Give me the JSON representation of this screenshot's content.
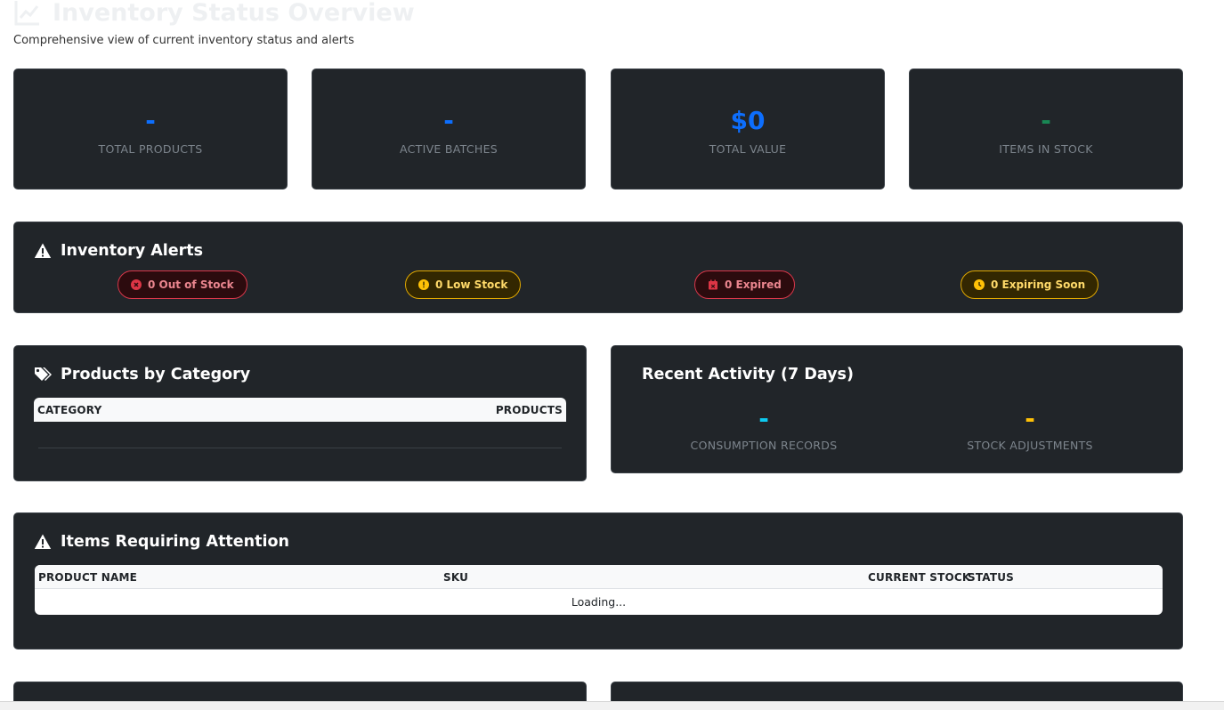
{
  "header": {
    "title": "Inventory Status Overview",
    "title_icon": "chart-line-icon",
    "subtitle": "Comprehensive view of current inventory status and alerts"
  },
  "stats": [
    {
      "value": "-",
      "label": "TOTAL PRODUCTS",
      "color": "#0d6efd"
    },
    {
      "value": "-",
      "label": "ACTIVE BATCHES",
      "color": "#0d6efd"
    },
    {
      "value": "$0",
      "label": "TOTAL VALUE",
      "color": "#0d6efd"
    },
    {
      "value": "-",
      "label": "ITEMS IN STOCK",
      "color": "#198754"
    }
  ],
  "alerts": {
    "title": "Inventory Alerts",
    "icon": "warning-triangle-icon",
    "badges": [
      {
        "label": "0 Out of Stock",
        "icon": "x-circle-icon",
        "color": "#dc3545"
      },
      {
        "label": "0 Low Stock",
        "icon": "exclamation-circle-icon",
        "color": "#ffc107"
      },
      {
        "label": "0 Expired",
        "icon": "calendar-x-icon",
        "color": "#dc3545"
      },
      {
        "label": "0 Expiring Soon",
        "icon": "clock-icon",
        "color": "#ffc107"
      }
    ]
  },
  "category": {
    "title": "Products by Category",
    "icon": "tags-icon",
    "columns": [
      "CATEGORY",
      "PRODUCTS"
    ]
  },
  "activity": {
    "title": "Recent Activity (7 Days)",
    "items": [
      {
        "value": "-",
        "label": "CONSUMPTION RECORDS",
        "color": "#0dcaf0"
      },
      {
        "value": "-",
        "label": "STOCK ADJUSTMENTS",
        "color": "#ffc107"
      }
    ]
  },
  "attention": {
    "title": "Items Requiring Attention",
    "icon": "warning-triangle-icon",
    "columns": [
      "PRODUCT NAME",
      "SKU",
      "CURRENT STOCK",
      "STATUS"
    ],
    "loading_text": "Loading..."
  }
}
